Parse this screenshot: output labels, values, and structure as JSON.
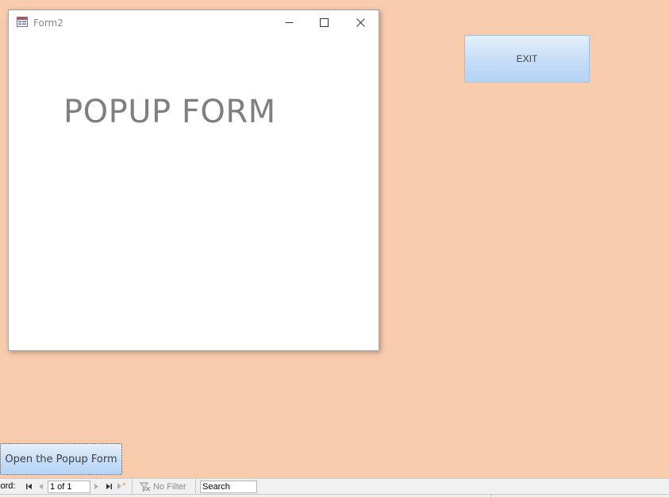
{
  "popup": {
    "title": "Form2",
    "heading": "POPUP FORM"
  },
  "buttons": {
    "exit_label": "EXIT",
    "open_popup_label": "Open the Popup Form"
  },
  "navigation": {
    "record_label": "cord:",
    "record_value": "1 of 1",
    "filter_label": "No Filter",
    "search_value": "Search"
  },
  "colors": {
    "background": "#f8cbad",
    "button_blue": "#c5ddf7",
    "heading_gray": "#7f7f7f"
  }
}
